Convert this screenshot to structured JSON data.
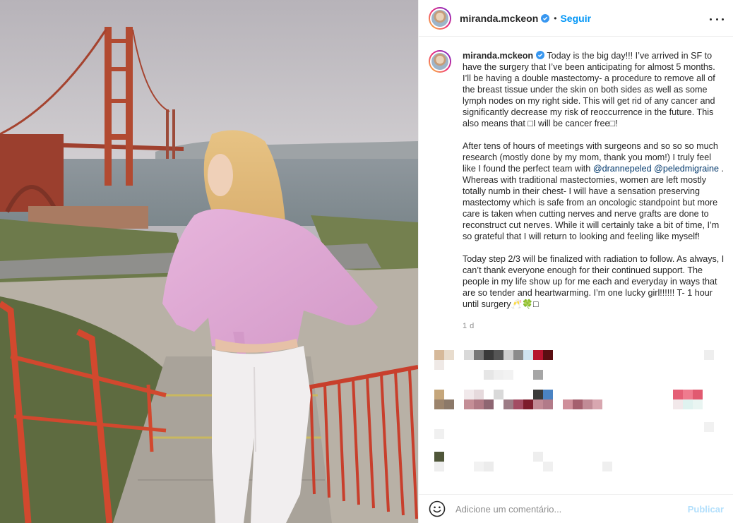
{
  "post": {
    "username": "miranda.mckeon",
    "verified": true,
    "follow_label": "Seguir",
    "dot": "•",
    "caption_user": "miranda.mckeon",
    "caption_p1": " Today is the big day!!! I’ve arrived in SF to have the surgery that I’ve been anticipating for almost 5 months. I’ll be having a double mastectomy- a procedure to remove all of the breast tissue under the skin on both sides as well as some lymph nodes on my right side. This will get rid of any cancer and significantly decrease my risk of reoccurrence in the future. This also means that □I will be cancer free□!\n\nAfter tens of hours of meetings with surgeons and so so so much research (mostly done by my mom, thank you mom!) I truly feel like I found the perfect team with ",
    "mention_1": "@drannepeled",
    "caption_p2": " ",
    "mention_2": "@peledmigraine",
    "caption_p3": " . Whereas with traditional mastectomies, women are left mostly totally numb in their chest- I will have a sensation preserving mastectomy which is safe from an oncologic standpoint but more care is taken when cutting nerves and nerve grafts are done to reconstruct cut nerves. While it will certainly take a bit of time, I’m so grateful that I will return to looking and feeling like myself!\n\nToday step 2/3 will be finalized with radiation to follow. As always, I can’t thank everyone enough for their continued support. The people in my life show up for me each and everyday in ways that are so tender and heartwarming. I’m one lucky girl!!!!!! T- 1 hour until surgery🥂🍀□",
    "timestamp": "1 d"
  },
  "add_comment": {
    "placeholder": "Adicione um comentário...",
    "publish_label": "Publicar"
  },
  "icons": {
    "verified": "verified-badge-icon",
    "more": "more-options-icon",
    "emoji": "emoji-smiley-icon"
  },
  "colors": {
    "accent": "#0095f6",
    "publish_disabled": "#b2dffc",
    "verified": "#3897f0",
    "mention": "#00376b",
    "muted": "#8e8e8e"
  }
}
